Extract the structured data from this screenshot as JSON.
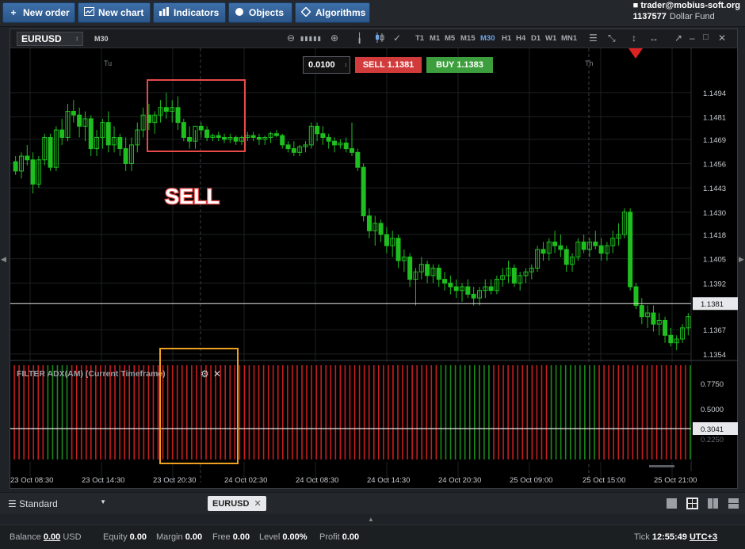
{
  "toolbar": {
    "new_order": "New order",
    "new_chart": "New chart",
    "indicators": "Indicators",
    "objects": "Objects",
    "algorithms": "Algorithms"
  },
  "account": {
    "email": "trader@mobius-soft.org",
    "number": "1137577",
    "fund": "Dollar Fund"
  },
  "chart": {
    "symbol": "EURUSD",
    "timeframe": "M30",
    "timeframes": [
      "T1",
      "M1",
      "M5",
      "M15",
      "M30",
      "H1",
      "H4",
      "D1",
      "W1",
      "MN1"
    ],
    "active_timeframe": "M30",
    "lot": "0.0100",
    "sell_label": "SELL 1.1381",
    "buy_label": "BUY 1.1383",
    "day_labels": [
      "Tu",
      "Th"
    ],
    "price_ticks": [
      "1.1494",
      "1.1481",
      "1.1469",
      "1.1456",
      "1.1443",
      "1.1430",
      "1.1418",
      "1.1405",
      "1.1392",
      "1.1367",
      "1.1354"
    ],
    "current_price": "1.1381",
    "annotation": "SELL",
    "indicator_title": "FILTER ADX(AM) (Current Timeframe)",
    "indicator_ticks": [
      "0.7750",
      "0.5000"
    ],
    "indicator_level": "0.3041",
    "indicator_partial_tick": "0.2250",
    "time_labels": [
      "23 Oct 08:30",
      "23 Oct 14:30",
      "23 Oct 20:30",
      "24 Oct 02:30",
      "24 Oct 08:30",
      "24 Oct 14:30",
      "24 Oct 20:30",
      "25 Oct 09:00",
      "25 Oct 15:00",
      "25 Oct 21:00"
    ],
    "colors": {
      "up": "#1fbf1f",
      "down": "#1fbf1f",
      "indicator_red": "#c81e1e",
      "indicator_green": "#1c8a1c",
      "sell_box": "#e84a4a",
      "indicator_box": "#f0a020"
    }
  },
  "chart_data": {
    "type": "candlestick",
    "ylim": [
      1.1348,
      1.1505
    ],
    "ohlc": [
      [
        1.1457,
        1.146,
        1.145,
        1.1452
      ],
      [
        1.1452,
        1.1462,
        1.1448,
        1.146
      ],
      [
        1.146,
        1.1466,
        1.1455,
        1.1458
      ],
      [
        1.1458,
        1.1462,
        1.144,
        1.1445
      ],
      [
        1.1445,
        1.146,
        1.1443,
        1.1458
      ],
      [
        1.1458,
        1.1472,
        1.1455,
        1.147
      ],
      [
        1.147,
        1.1472,
        1.1452,
        1.1454
      ],
      [
        1.1454,
        1.1476,
        1.1452,
        1.1474
      ],
      [
        1.1474,
        1.148,
        1.1466,
        1.147
      ],
      [
        1.147,
        1.1488,
        1.1468,
        1.1484
      ],
      [
        1.1484,
        1.149,
        1.1478,
        1.1482
      ],
      [
        1.1482,
        1.1486,
        1.147,
        1.1476
      ],
      [
        1.1476,
        1.1484,
        1.1468,
        1.148
      ],
      [
        1.148,
        1.1482,
        1.146,
        1.1464
      ],
      [
        1.1464,
        1.1474,
        1.146,
        1.147
      ],
      [
        1.147,
        1.148,
        1.1464,
        1.1478
      ],
      [
        1.1478,
        1.1484,
        1.1462,
        1.1466
      ],
      [
        1.1466,
        1.1476,
        1.1462,
        1.147
      ],
      [
        1.147,
        1.1472,
        1.146,
        1.1464
      ],
      [
        1.1464,
        1.147,
        1.1452,
        1.1456
      ],
      [
        1.1456,
        1.147,
        1.1452,
        1.1466
      ],
      [
        1.1466,
        1.1478,
        1.1462,
        1.1474
      ],
      [
        1.1474,
        1.1486,
        1.147,
        1.1482
      ],
      [
        1.1482,
        1.1488,
        1.1474,
        1.1478
      ],
      [
        1.1478,
        1.1484,
        1.1472,
        1.1482
      ],
      [
        1.1482,
        1.149,
        1.1478,
        1.1486
      ],
      [
        1.1486,
        1.1494,
        1.148,
        1.1484
      ],
      [
        1.1484,
        1.149,
        1.1478,
        1.1486
      ],
      [
        1.1486,
        1.1492,
        1.1474,
        1.1478
      ],
      [
        1.1478,
        1.148,
        1.1468,
        1.147
      ],
      [
        1.147,
        1.1476,
        1.1464,
        1.1468
      ],
      [
        1.1468,
        1.1474,
        1.1464,
        1.1476
      ],
      [
        1.1476,
        1.1478,
        1.147,
        1.1474
      ],
      [
        1.1474,
        1.1476,
        1.1468,
        1.147
      ],
      [
        1.147,
        1.1472,
        1.1468,
        1.1471
      ],
      [
        1.1471,
        1.1473,
        1.1468,
        1.147
      ],
      [
        1.147,
        1.1472,
        1.1467,
        1.1469
      ],
      [
        1.1469,
        1.1472,
        1.1467,
        1.147
      ],
      [
        1.147,
        1.1471,
        1.1466,
        1.1468
      ],
      [
        1.1468,
        1.1471,
        1.1466,
        1.147
      ],
      [
        1.147,
        1.1473,
        1.1468,
        1.1471
      ],
      [
        1.1471,
        1.1473,
        1.1468,
        1.147
      ],
      [
        1.147,
        1.1472,
        1.1466,
        1.1469
      ],
      [
        1.1469,
        1.1471,
        1.1466,
        1.147
      ],
      [
        1.147,
        1.1473,
        1.1467,
        1.1472
      ],
      [
        1.1472,
        1.1474,
        1.147,
        1.1471
      ],
      [
        1.1471,
        1.1472,
        1.1464,
        1.1466
      ],
      [
        1.1466,
        1.1468,
        1.1462,
        1.1464
      ],
      [
        1.1464,
        1.1468,
        1.146,
        1.1462
      ],
      [
        1.1462,
        1.1466,
        1.146,
        1.1465
      ],
      [
        1.1465,
        1.1468,
        1.1462,
        1.1466
      ],
      [
        1.1466,
        1.1478,
        1.1464,
        1.1476
      ],
      [
        1.1476,
        1.1478,
        1.1468,
        1.1472
      ],
      [
        1.1472,
        1.1476,
        1.1466,
        1.147
      ],
      [
        1.147,
        1.1472,
        1.1464,
        1.1468
      ],
      [
        1.1468,
        1.147,
        1.1462,
        1.1466
      ],
      [
        1.1466,
        1.1469,
        1.1464,
        1.1467
      ],
      [
        1.1467,
        1.147,
        1.1462,
        1.1464
      ],
      [
        1.1464,
        1.1478,
        1.146,
        1.1462
      ],
      [
        1.1462,
        1.1464,
        1.1452,
        1.1454
      ],
      [
        1.1454,
        1.1456,
        1.1425,
        1.1428
      ],
      [
        1.1428,
        1.1432,
        1.1416,
        1.142
      ],
      [
        1.142,
        1.1428,
        1.1412,
        1.1424
      ],
      [
        1.1424,
        1.1426,
        1.1414,
        1.1418
      ],
      [
        1.1418,
        1.1422,
        1.1408,
        1.1412
      ],
      [
        1.1412,
        1.142,
        1.1406,
        1.1416
      ],
      [
        1.1416,
        1.1418,
        1.14,
        1.1404
      ],
      [
        1.1404,
        1.141,
        1.1398,
        1.1406
      ],
      [
        1.1406,
        1.1408,
        1.139,
        1.1394
      ],
      [
        1.1394,
        1.14,
        1.138,
        1.1398
      ],
      [
        1.1398,
        1.1406,
        1.1394,
        1.1402
      ],
      [
        1.1402,
        1.1404,
        1.1392,
        1.1396
      ],
      [
        1.1396,
        1.1402,
        1.1392,
        1.14
      ],
      [
        1.14,
        1.1402,
        1.139,
        1.1394
      ],
      [
        1.1394,
        1.1398,
        1.1388,
        1.1392
      ],
      [
        1.1392,
        1.1396,
        1.1386,
        1.139
      ],
      [
        1.139,
        1.1394,
        1.1384,
        1.1388
      ],
      [
        1.1388,
        1.1392,
        1.1382,
        1.139
      ],
      [
        1.139,
        1.1394,
        1.1384,
        1.1386
      ],
      [
        1.1386,
        1.139,
        1.138,
        1.1384
      ],
      [
        1.1384,
        1.139,
        1.138,
        1.1388
      ],
      [
        1.1388,
        1.1394,
        1.1384,
        1.139
      ],
      [
        1.139,
        1.1394,
        1.1386,
        1.1388
      ],
      [
        1.1388,
        1.1396,
        1.1386,
        1.1394
      ],
      [
        1.1394,
        1.14,
        1.139,
        1.1396
      ],
      [
        1.1396,
        1.1404,
        1.1392,
        1.14
      ],
      [
        1.14,
        1.1402,
        1.139,
        1.1392
      ],
      [
        1.1392,
        1.1398,
        1.1388,
        1.1396
      ],
      [
        1.1396,
        1.14,
        1.1392,
        1.1398
      ],
      [
        1.1398,
        1.1402,
        1.1394,
        1.14
      ],
      [
        1.14,
        1.1412,
        1.1398,
        1.141
      ],
      [
        1.141,
        1.1414,
        1.1404,
        1.1408
      ],
      [
        1.1408,
        1.1416,
        1.1404,
        1.1414
      ],
      [
        1.1414,
        1.142,
        1.1408,
        1.1412
      ],
      [
        1.1412,
        1.1418,
        1.1406,
        1.141
      ],
      [
        1.141,
        1.1412,
        1.1398,
        1.1402
      ],
      [
        1.1402,
        1.1408,
        1.1398,
        1.1406
      ],
      [
        1.1406,
        1.1416,
        1.1404,
        1.1414
      ],
      [
        1.1414,
        1.1418,
        1.1408,
        1.141
      ],
      [
        1.141,
        1.1416,
        1.1406,
        1.1414
      ],
      [
        1.1414,
        1.142,
        1.141,
        1.1412
      ],
      [
        1.1412,
        1.1416,
        1.1404,
        1.1408
      ],
      [
        1.1408,
        1.1414,
        1.1404,
        1.1412
      ],
      [
        1.1412,
        1.142,
        1.1408,
        1.1416
      ],
      [
        1.1416,
        1.1424,
        1.1412,
        1.1418
      ],
      [
        1.1418,
        1.1432,
        1.1416,
        1.143
      ],
      [
        1.143,
        1.1432,
        1.1388,
        1.139
      ],
      [
        1.139,
        1.1392,
        1.1378,
        1.138
      ],
      [
        1.138,
        1.1384,
        1.137,
        1.1374
      ],
      [
        1.1374,
        1.138,
        1.1368,
        1.1376
      ],
      [
        1.1376,
        1.138,
        1.1366,
        1.137
      ],
      [
        1.137,
        1.1376,
        1.1364,
        1.1372
      ],
      [
        1.1372,
        1.1374,
        1.136,
        1.1364
      ],
      [
        1.1364,
        1.1368,
        1.1358,
        1.136
      ],
      [
        1.136,
        1.1364,
        1.1356,
        1.1362
      ],
      [
        1.1362,
        1.137,
        1.136,
        1.1368
      ],
      [
        1.1368,
        1.1376,
        1.1364,
        1.1374
      ]
    ],
    "indicator_colors": "RRRRRRRGGGGGRRRRRRRRRRRRRRRRRRRRRRRRRRRRRRRRRRRRRRRRRRRRRRRRRRRRRRRRRRRRRRRRRRRRRRRRRRRRRGGGGGGGGGGGRRRRRRRRRRRRGGGGGGGGGGRRRRRRRRRRRRRRRRRRRG",
    "indicator_level": 0.3041
  },
  "bottom": {
    "workspace": "Standard",
    "chart_tab": "EURUSD"
  },
  "status": {
    "balance_label": "Balance",
    "balance_value": "0.00",
    "balance_currency": "USD",
    "equity_label": "Equity",
    "equity_value": "0.00",
    "margin_label": "Margin",
    "margin_value": "0.00",
    "free_label": "Free",
    "free_value": "0.00",
    "level_label": "Level",
    "level_value": "0.00%",
    "profit_label": "Profit",
    "profit_value": "0.00",
    "tick_label": "Tick",
    "tick_time": "12:55:49",
    "timezone": "UTC+3"
  }
}
